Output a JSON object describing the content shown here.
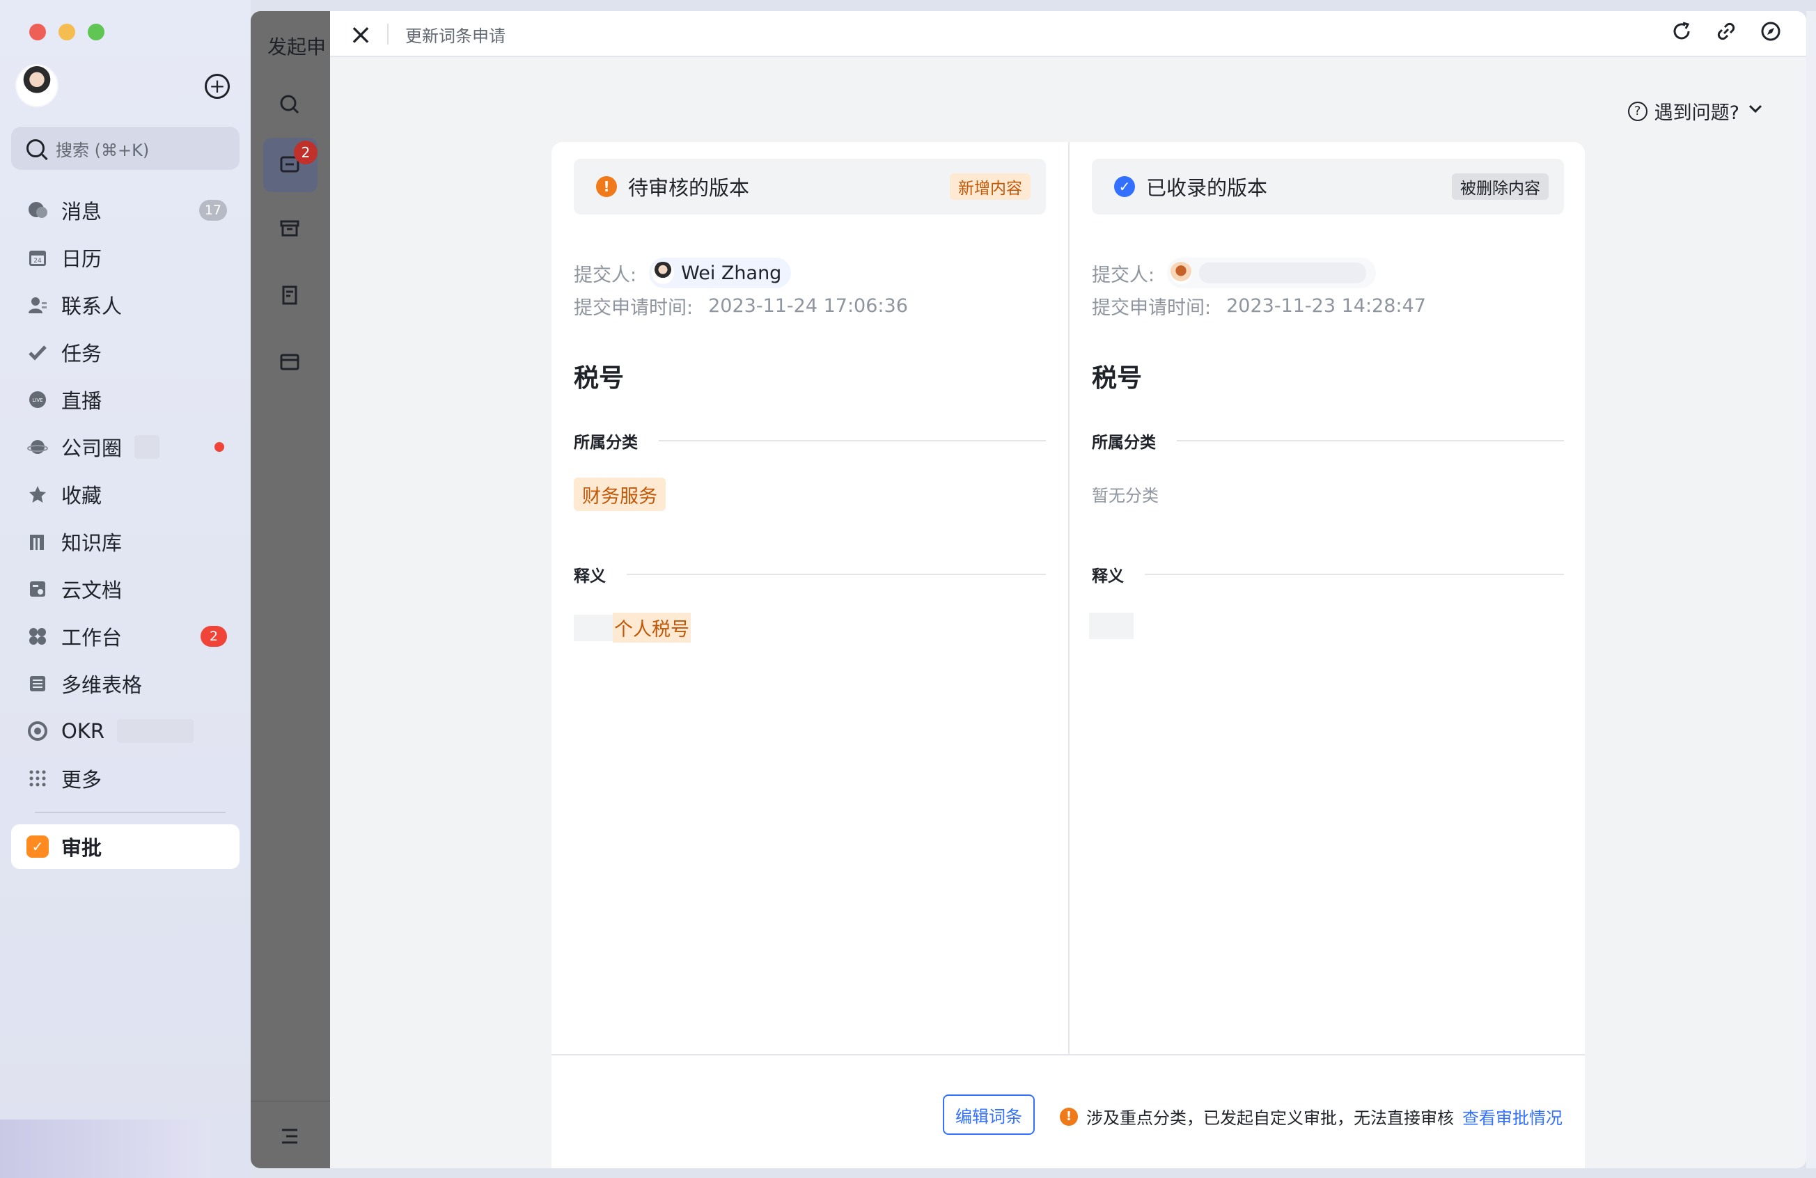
{
  "sidebar": {
    "search_placeholder": "搜索 (⌘+K)",
    "items": [
      {
        "label": "消息",
        "icon": "chat-bubble-icon",
        "badge": "17"
      },
      {
        "label": "日历",
        "icon": "calendar-icon",
        "badge": ""
      },
      {
        "label": "联系人",
        "icon": "contacts-icon",
        "badge": ""
      },
      {
        "label": "任务",
        "icon": "task-check-icon",
        "badge": ""
      },
      {
        "label": "直播",
        "icon": "live-icon",
        "badge": ""
      },
      {
        "label": "公司圈",
        "icon": "planet-icon",
        "badge": ""
      },
      {
        "label": "收藏",
        "icon": "star-icon",
        "badge": ""
      },
      {
        "label": "知识库",
        "icon": "book-icon",
        "badge": ""
      },
      {
        "label": "云文档",
        "icon": "doc-icon",
        "badge": ""
      },
      {
        "label": "工作台",
        "icon": "grid-icon",
        "badge": "2"
      },
      {
        "label": "多维表格",
        "icon": "table-icon",
        "badge": ""
      },
      {
        "label": "OKR",
        "icon": "target-icon",
        "badge": ""
      },
      {
        "label": "更多",
        "icon": "dots-grid-icon",
        "badge": ""
      }
    ],
    "active_item": "审批"
  },
  "midcol": {
    "title_fragment": "发起申",
    "badge": "2"
  },
  "window": {
    "title": "更新词条申请",
    "help": "遇到问题?"
  },
  "pending": {
    "header": "待审核的版本",
    "tag": "新增内容",
    "submitter_label": "提交人:",
    "submitter_name": "Wei Zhang",
    "time_label": "提交申请时间:",
    "time_value": "2023-11-24 17:06:36",
    "word": "税号",
    "category_heading": "所属分类",
    "category": "财务服务",
    "definition_heading": "释义",
    "definition": "个人税号"
  },
  "recorded": {
    "header": "已收录的版本",
    "tag": "被删除内容",
    "submitter_label": "提交人:",
    "time_label": "提交申请时间:",
    "time_value": "2023-11-23 14:28:47",
    "word": "税号",
    "category_heading": "所属分类",
    "category_empty": "暂无分类",
    "definition_heading": "释义"
  },
  "footer": {
    "edit_button": "编辑词条",
    "notice": "涉及重点分类，已发起自定义审批，无法直接审核",
    "notice_link": "查看审批情况"
  },
  "colors": {
    "accent_blue": "#3370ff",
    "warning_orange": "#f07a1a",
    "added_bg": "#feead2",
    "added_text": "#c0580a",
    "badge_red": "#f04438",
    "active_orange": "#ff8a1f"
  }
}
